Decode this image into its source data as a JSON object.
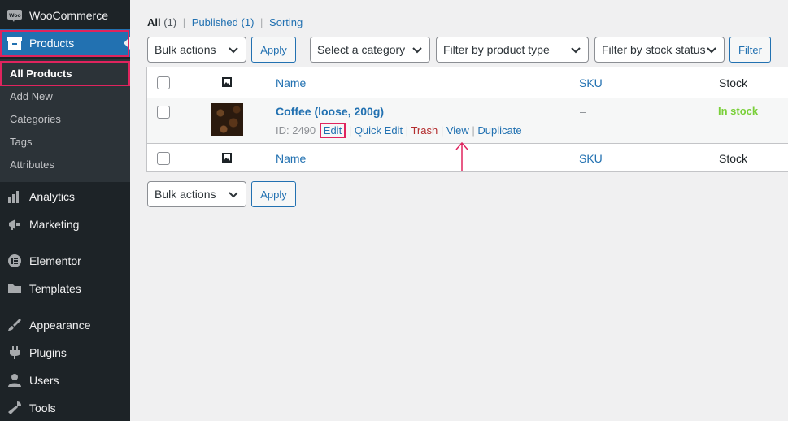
{
  "sidebar": {
    "woocommerce": "WooCommerce",
    "products": "Products",
    "submenu": [
      "All Products",
      "Add New",
      "Categories",
      "Tags",
      "Attributes"
    ],
    "menu": [
      "Analytics",
      "Marketing",
      "Elementor",
      "Templates",
      "Appearance",
      "Plugins",
      "Users",
      "Tools"
    ]
  },
  "views": {
    "all_label": "All",
    "all_count": "(1)",
    "published_label": "Published",
    "published_count": "(1)",
    "sorting_label": "Sorting"
  },
  "toolbar": {
    "bulk_actions": "Bulk actions",
    "apply": "Apply",
    "category_select": "Select a category",
    "type_select": "Filter by product type",
    "stock_select": "Filter by stock status",
    "filter": "Filter"
  },
  "table": {
    "col_name": "Name",
    "col_sku": "SKU",
    "col_stock": "Stock",
    "product": {
      "title": "Coffee (loose, 200g)",
      "id_label": "ID: 2490",
      "sku": "–",
      "stock": "In stock",
      "actions": {
        "edit": "Edit",
        "quick_edit": "Quick Edit",
        "trash": "Trash",
        "view": "View",
        "duplicate": "Duplicate"
      }
    }
  },
  "colors": {
    "sidebar_bg": "#1d2327",
    "accent": "#2271b1",
    "highlight": "#e0245e",
    "in_stock": "#7ad03a"
  }
}
